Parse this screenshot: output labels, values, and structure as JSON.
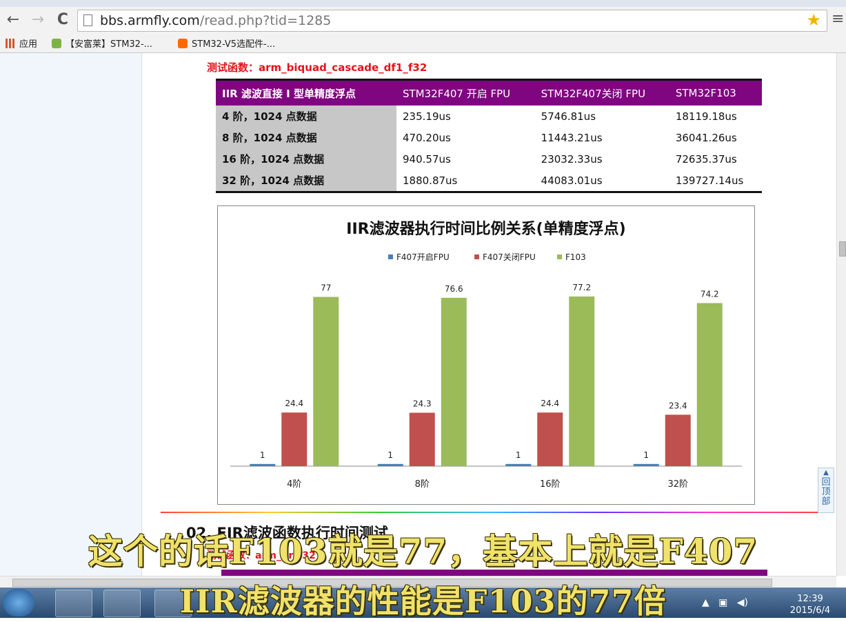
{
  "browser": {
    "url_domain": "bbs.armfly.com",
    "url_path": "/read.php?tid=1285",
    "bookmarks": [
      "应用",
      "【安富莱】STM32-...",
      "STM32-V5选配件-..."
    ]
  },
  "article": {
    "test_function_label": "测试函数：arm_biquad_cascade_df1_f32",
    "table": {
      "headers": [
        "IIR 滤波直接 I 型单精度浮点",
        "STM32F407 开启 FPU",
        "STM32F407关闭 FPU",
        "STM32F103"
      ],
      "rows": [
        [
          "4 阶，1024 点数据",
          "235.19us",
          "5746.81us",
          "18119.18us"
        ],
        [
          "8 阶，1024 点数据",
          "470.20us",
          "11443.21us",
          "36041.26us"
        ],
        [
          "16 阶，1024 点数据",
          "940.57us",
          "23032.33us",
          "72635.37us"
        ],
        [
          "32 阶，1024 点数据",
          "1880.87us",
          "44083.01us",
          "139727.14us"
        ]
      ]
    },
    "section_title": "02. FIR滤波函数执行时间测试",
    "section_func": "测试函数：arm_fir_f32",
    "to_top": "回顶部"
  },
  "chart_data": {
    "type": "bar",
    "title": "IIR滤波器执行时间比例关系(单精度浮点)",
    "categories": [
      "4阶",
      "8阶",
      "16阶",
      "32阶"
    ],
    "series": [
      {
        "name": "F407开启FPU",
        "values": [
          1,
          1,
          1,
          1
        ],
        "color": "#4a7ebb"
      },
      {
        "name": "F407关闭FPU",
        "values": [
          24.4,
          24.3,
          24.4,
          23.4
        ],
        "color": "#c0504d"
      },
      {
        "name": "F103",
        "values": [
          77,
          76.6,
          77.2,
          74.2
        ],
        "color": "#9bbb59"
      }
    ],
    "legend": "top",
    "ylim": [
      0,
      80
    ],
    "grid": false,
    "data_labels": true
  },
  "subtitles": {
    "line1": "这个的话F103就是77，基本上就是F407",
    "line2": "IIR滤波器的性能是F103的77倍"
  },
  "taskbar": {
    "time": "12:39",
    "date": "2015/6/4"
  }
}
